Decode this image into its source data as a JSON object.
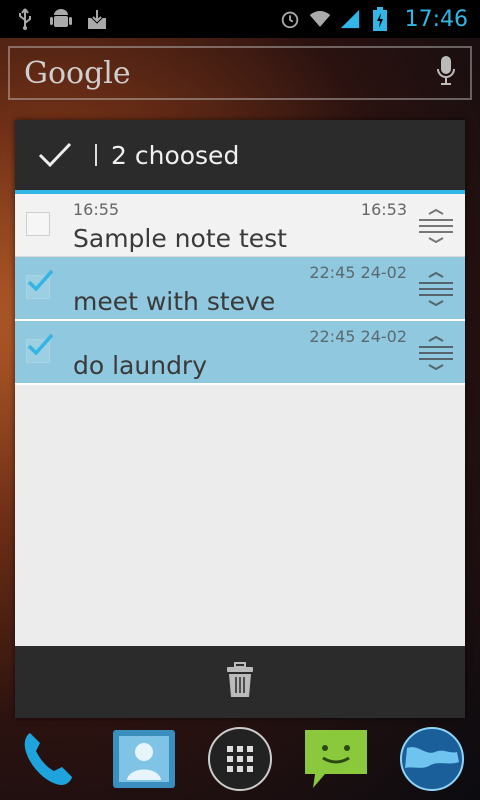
{
  "status_bar": {
    "left_icons": [
      "usb-icon",
      "android-debug-icon",
      "download-icon"
    ],
    "right_icons": [
      "alarm-icon",
      "wifi-icon",
      "signal-icon",
      "battery-charging-icon"
    ],
    "time": "17:46"
  },
  "search": {
    "logo": "Google",
    "icon": "mic-icon"
  },
  "action_bar": {
    "selection_count": "2 choosed",
    "done_icon": "checkmark-icon"
  },
  "notes": [
    {
      "left_time": "16:55",
      "right_time": "16:53",
      "title": "Sample note test",
      "checked": false
    },
    {
      "left_time": "",
      "right_time": "22:45 24-02",
      "title": "meet with steve",
      "checked": true
    },
    {
      "left_time": "",
      "right_time": "22:45 24-02",
      "title": "do laundry",
      "checked": true
    }
  ],
  "bottom_bar": {
    "icon": "trash-icon"
  },
  "dock": [
    "phone-icon",
    "contacts-icon",
    "app-drawer-icon",
    "messaging-icon",
    "browser-globe-icon"
  ],
  "colors": {
    "accent": "#33b5e5",
    "selected_row": "#8fc8df",
    "dark_bar": "#2b2b2b"
  }
}
